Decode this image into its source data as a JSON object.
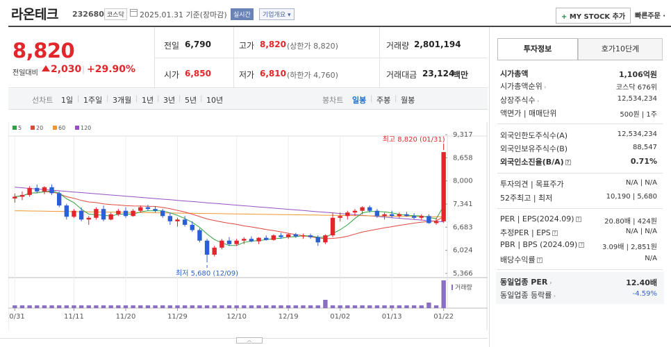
{
  "header": {
    "company_name": "라온테크",
    "code": "232680",
    "market": "코스닥",
    "as_of": "2025.01.31 기준(장마감)",
    "realtime_label": "실시간",
    "overview_label": "기업개요 ▾",
    "mystock_label": "MY STOCK 추가",
    "quick_order_label": "빠른주문 ·"
  },
  "price": {
    "current": "8,820",
    "change_label": "전일대비",
    "change_amount": "2,030",
    "change_percent": "+29.90%",
    "color_up": "#e1262c"
  },
  "stats": {
    "prev_close_label": "전일",
    "prev_close": "6,790",
    "high_label": "고가",
    "high": "8,820",
    "upper_limit": "(상한가 8,820)",
    "volume_label": "거래량",
    "volume": "2,801,194",
    "open_label": "시가",
    "open": "6,850",
    "low_label": "저가",
    "low": "6,810",
    "lower_limit": "(하한가 4,760)",
    "value_label": "거래대금",
    "value": "23,124",
    "value_unit": "백만"
  },
  "period_tabs": {
    "line_label": "선차트",
    "line_periods": [
      "1일",
      "1주일",
      "3개월",
      "1년",
      "3년",
      "5년",
      "10년"
    ],
    "candle_label": "봉차트",
    "candle_periods": [
      "일봉",
      "주봉",
      "월봉"
    ],
    "active_candle": "일봉"
  },
  "right_panel": {
    "tabs": [
      "투자정보",
      "호가10단계"
    ],
    "rows": [
      {
        "label": "시가총액",
        "value": "1,106억원",
        "bold": true
      },
      {
        "label": "시가총액순위",
        "value": "코스닥 676위"
      },
      {
        "label": "상장주식수",
        "value": "12,534,234"
      },
      {
        "label": "액면가 | 매매단위",
        "value": "500원 | 1주"
      },
      {
        "label": "외국인한도주식수(A)",
        "value": "12,534,234"
      },
      {
        "label": "외국인보유주식수(B)",
        "value": "88,547"
      },
      {
        "label": "외국인소진율(B/A)",
        "value": "0.71%",
        "bold": true
      },
      {
        "label": "투자의견 | 목표주가",
        "value": "N/A | N/A"
      },
      {
        "label": "52주최고 | 최저",
        "value": "10,190 | 5,680"
      },
      {
        "label": "PER | EPS(2024.09)",
        "value": "20.80배 | 424원"
      },
      {
        "label": "추정PER | EPS",
        "value": "N/A | N/A"
      },
      {
        "label": "PBR | BPS (2024.09)",
        "value": "3.09배 | 2,851원"
      },
      {
        "label": "배당수익률",
        "value": "N/A"
      },
      {
        "label": "동일업종 PER",
        "value": "12.40배",
        "bold": true
      },
      {
        "label": "동일업종 등락률",
        "value": "-4.59%",
        "blue": true
      }
    ]
  },
  "chart_data": {
    "type": "candlestick",
    "legend": [
      {
        "name": "5",
        "color": "#2fa33f"
      },
      {
        "name": "20",
        "color": "#e0473d"
      },
      {
        "name": "60",
        "color": "#f0962d"
      },
      {
        "name": "120",
        "color": "#9550c2"
      }
    ],
    "y_ticks": [
      "9,317",
      "8,658",
      "8,000",
      "7,341",
      "6,683",
      "6,024",
      "5,366"
    ],
    "ylim": [
      5366,
      9317
    ],
    "x_ticks": [
      "10/31",
      "11/11",
      "11/20",
      "11/29",
      "12/10",
      "12/19",
      "01/02",
      "01/13",
      "01/22"
    ],
    "max_label": "최고 8,820 (01/31)",
    "min_label": "최저 5,680 (12/09)",
    "volume_label": "거래량",
    "candles": [
      [
        7500,
        7640,
        7380,
        7550
      ],
      [
        7550,
        7700,
        7450,
        7600
      ],
      [
        7600,
        7850,
        7550,
        7800
      ],
      [
        7800,
        7900,
        7650,
        7700
      ],
      [
        7700,
        7850,
        7620,
        7820
      ],
      [
        7820,
        7900,
        7600,
        7650
      ],
      [
        7650,
        7700,
        7250,
        7300
      ],
      [
        7300,
        7350,
        6900,
        6980
      ],
      [
        6980,
        7200,
        6950,
        7150
      ],
      [
        7150,
        7250,
        6850,
        6900
      ],
      [
        6900,
        7000,
        6750,
        6950
      ],
      [
        6950,
        7250,
        6900,
        7200
      ],
      [
        7200,
        7300,
        6850,
        6900
      ],
      [
        6900,
        7100,
        6880,
        7050
      ],
      [
        7050,
        7200,
        7000,
        7150
      ],
      [
        7150,
        7250,
        6950,
        7000
      ],
      [
        7000,
        7200,
        6980,
        7150
      ],
      [
        7150,
        7300,
        7100,
        7250
      ],
      [
        7250,
        7320,
        7150,
        7200
      ],
      [
        7200,
        7280,
        7100,
        7150
      ],
      [
        7150,
        7200,
        6950,
        7000
      ],
      [
        7000,
        7100,
        6750,
        6850
      ],
      [
        6850,
        6950,
        6700,
        6900
      ],
      [
        6900,
        7000,
        6700,
        6750
      ],
      [
        6750,
        6850,
        6550,
        6600
      ],
      [
        6600,
        6650,
        6250,
        6300
      ],
      [
        6300,
        6350,
        5680,
        5900
      ],
      [
        5900,
        6150,
        5850,
        6100
      ],
      [
        6100,
        6350,
        6050,
        6300
      ],
      [
        6300,
        6400,
        6150,
        6200
      ],
      [
        6200,
        6350,
        6150,
        6300
      ],
      [
        6300,
        6400,
        6200,
        6350
      ],
      [
        6350,
        6420,
        6250,
        6280
      ],
      [
        6280,
        6400,
        6200,
        6380
      ],
      [
        6380,
        6450,
        6300,
        6320
      ],
      [
        6320,
        6480,
        6300,
        6450
      ],
      [
        6450,
        6520,
        6350,
        6400
      ],
      [
        6400,
        6500,
        6350,
        6480
      ],
      [
        6480,
        6520,
        6380,
        6420
      ],
      [
        6420,
        6500,
        6350,
        6450
      ],
      [
        6450,
        6500,
        6350,
        6400
      ],
      [
        6400,
        6450,
        6150,
        6250
      ],
      [
        6250,
        6480,
        6200,
        6450
      ],
      [
        6450,
        7100,
        6400,
        6950
      ],
      [
        6950,
        7100,
        6850,
        7000
      ],
      [
        7000,
        7150,
        6900,
        7100
      ],
      [
        7100,
        7200,
        7000,
        7150
      ],
      [
        7150,
        7280,
        7050,
        7250
      ],
      [
        7250,
        7300,
        7100,
        7150
      ],
      [
        7150,
        7200,
        6950,
        7000
      ],
      [
        7000,
        7100,
        6900,
        7050
      ],
      [
        7050,
        7150,
        6950,
        7000
      ],
      [
        7000,
        7100,
        6950,
        7050
      ],
      [
        7050,
        7120,
        6980,
        7000
      ],
      [
        7000,
        7080,
        6900,
        6950
      ],
      [
        6950,
        7050,
        6880,
        7000
      ],
      [
        7000,
        7050,
        6780,
        6800
      ],
      [
        6800,
        6950,
        6750,
        6850
      ],
      [
        6850,
        8820,
        6810,
        8820
      ]
    ],
    "volumes": [
      1,
      1,
      1,
      1,
      1,
      1,
      1,
      1,
      1,
      1,
      1,
      1,
      1,
      1,
      1,
      1,
      1,
      1,
      1,
      1,
      1,
      1,
      1,
      1,
      1,
      1,
      1,
      1,
      1,
      1,
      1,
      1,
      1,
      1,
      1,
      1,
      1,
      1,
      1,
      1,
      1,
      1,
      3,
      1,
      1,
      1,
      1,
      1,
      1,
      1,
      1,
      1,
      1,
      1,
      1,
      1,
      2,
      1,
      10
    ]
  }
}
